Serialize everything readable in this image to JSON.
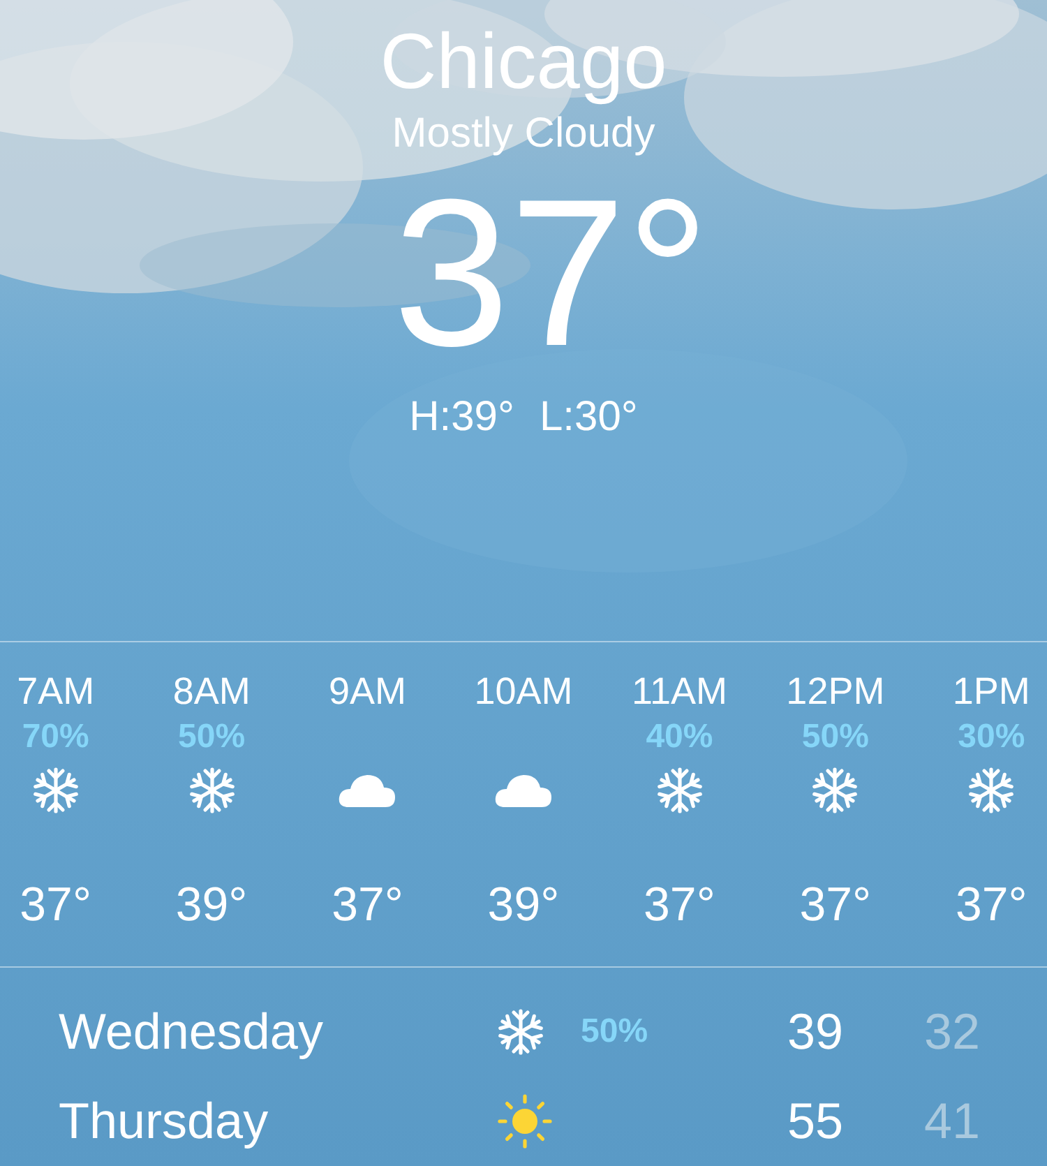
{
  "location": {
    "city": "Chicago",
    "condition": "Mostly Cloudy",
    "temperature": "37°",
    "high": "H:39°",
    "low": "L:30°"
  },
  "hourly": [
    {
      "time": "7AM",
      "chance": "70%",
      "kind": "snow",
      "temperature": "37°"
    },
    {
      "time": "8AM",
      "chance": "50%",
      "kind": "snow",
      "temperature": "39°"
    },
    {
      "time": "9AM",
      "kind": "cloud",
      "temperature": "37°"
    },
    {
      "time": "10AM",
      "kind": "cloud",
      "temperature": "39°"
    },
    {
      "time": "11AM",
      "chance": "40%",
      "kind": "snow",
      "temperature": "37°"
    },
    {
      "time": "12PM",
      "chance": "50%",
      "kind": "snow",
      "temperature": "37°"
    },
    {
      "time": "1PM",
      "chance": "30%",
      "kind": "snow",
      "temperature": "37°"
    }
  ],
  "daily": [
    {
      "day": "Wednesday",
      "kind": "snow",
      "chance": "50%",
      "high": "39",
      "low": "32"
    },
    {
      "day": "Thursday",
      "kind": "sun",
      "high": "55",
      "low": "41"
    }
  ]
}
